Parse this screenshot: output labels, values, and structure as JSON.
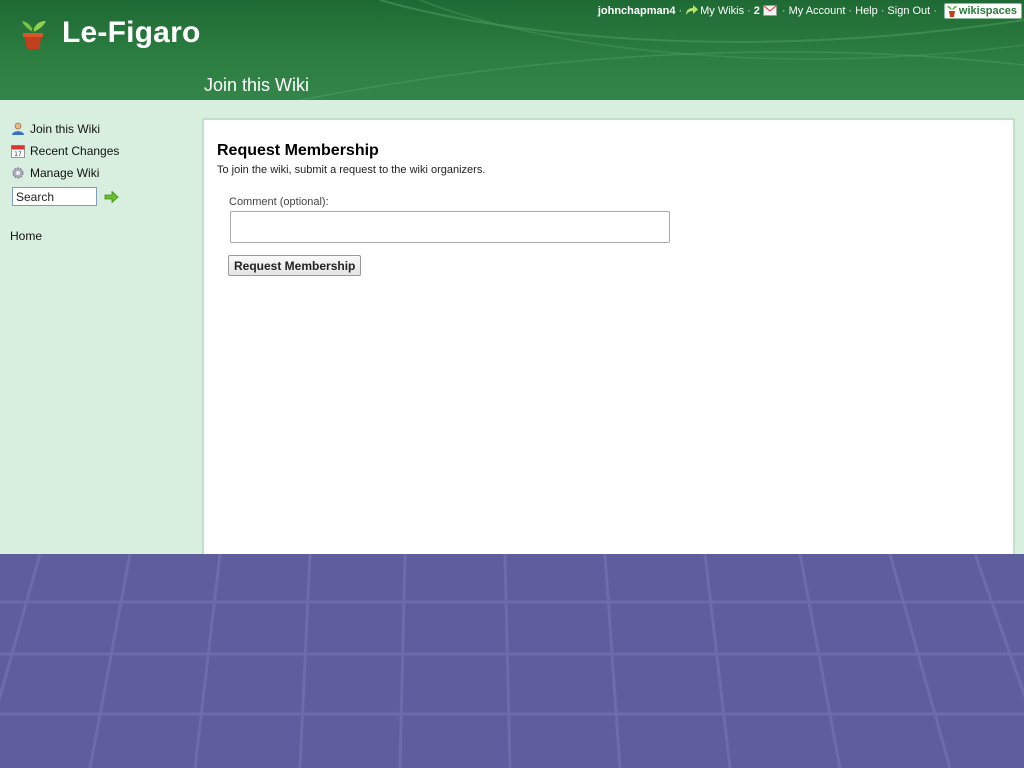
{
  "site": {
    "title": "Le-Figaro"
  },
  "header": {
    "page_heading": "Join this Wiki"
  },
  "topbar": {
    "username": "johnchapman4",
    "my_wikis": "My Wikis",
    "message_count": "2",
    "my_account": "My Account",
    "help": "Help",
    "sign_out": "Sign Out",
    "brand": "wikispaces",
    "separator": "·"
  },
  "sidebar": {
    "items": [
      {
        "label": "Join this Wiki",
        "icon": "user-icon"
      },
      {
        "label": "Recent Changes",
        "icon": "calendar-icon"
      },
      {
        "label": "Manage Wiki",
        "icon": "gear-icon"
      }
    ],
    "search": {
      "value": "Search"
    },
    "home": "Home"
  },
  "main": {
    "title": "Request Membership",
    "intro": "To join the wiki, submit a request to the wiki organizers.",
    "comment_label": "Comment (optional):",
    "comment_value": "",
    "submit_label": "Request Membership"
  },
  "colors": {
    "header_green": "#2b7d40",
    "sidebar_bg": "#d8efe0",
    "desktop_bg": "#5e5e9e"
  }
}
